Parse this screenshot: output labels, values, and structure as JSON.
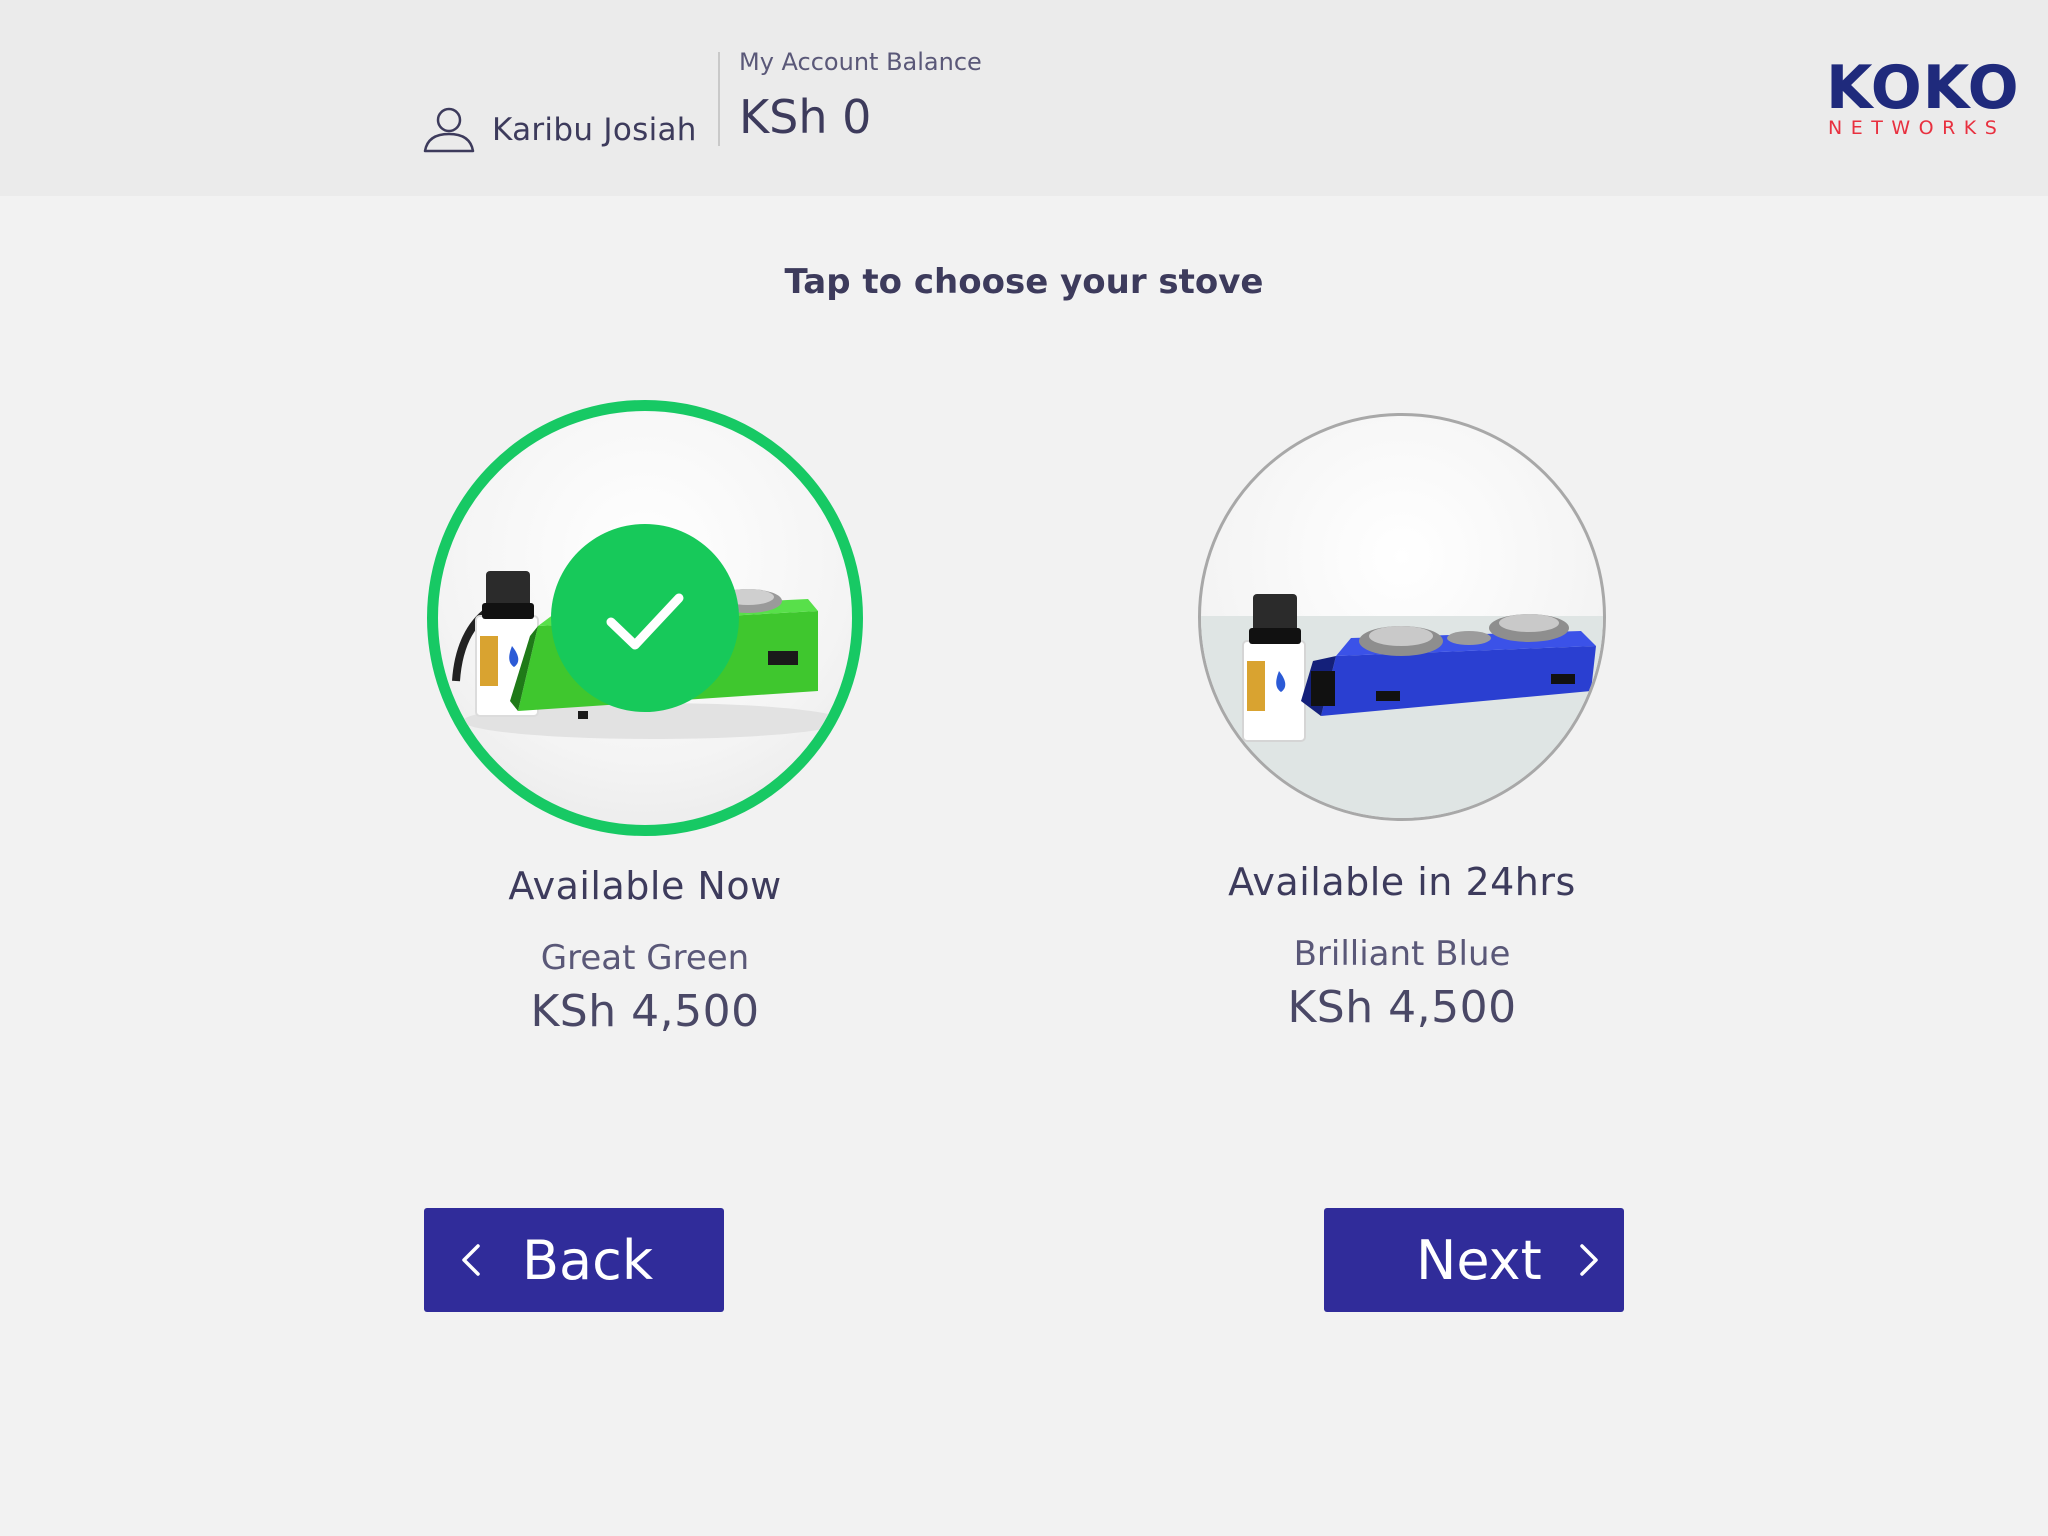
{
  "header": {
    "user_greeting": "Karibu Josiah",
    "balance_label": "My Account Balance",
    "balance_value": "KSh 0",
    "logo_main": "KOKO",
    "logo_sub": "NETWORKS"
  },
  "main": {
    "title": "Tap to choose your stove",
    "options": [
      {
        "availability": "Available Now",
        "name": "Great Green",
        "price": "KSh 4,500",
        "selected": true,
        "color": "#3fd23a"
      },
      {
        "availability": "Available in 24hrs",
        "name": "Brilliant Blue",
        "price": "KSh 4,500",
        "selected": false,
        "color": "#2a3fd1"
      }
    ]
  },
  "buttons": {
    "back_label": "Back",
    "next_label": "Next"
  },
  "colors": {
    "primary": "#302c9a",
    "selected_ring": "#17c964",
    "brand_blue": "#1f2a7c",
    "brand_red": "#e8303f"
  },
  "icons": {
    "user": "user-icon",
    "check": "checkmark-icon",
    "back": "chevron-left-icon",
    "next": "chevron-right-icon"
  }
}
